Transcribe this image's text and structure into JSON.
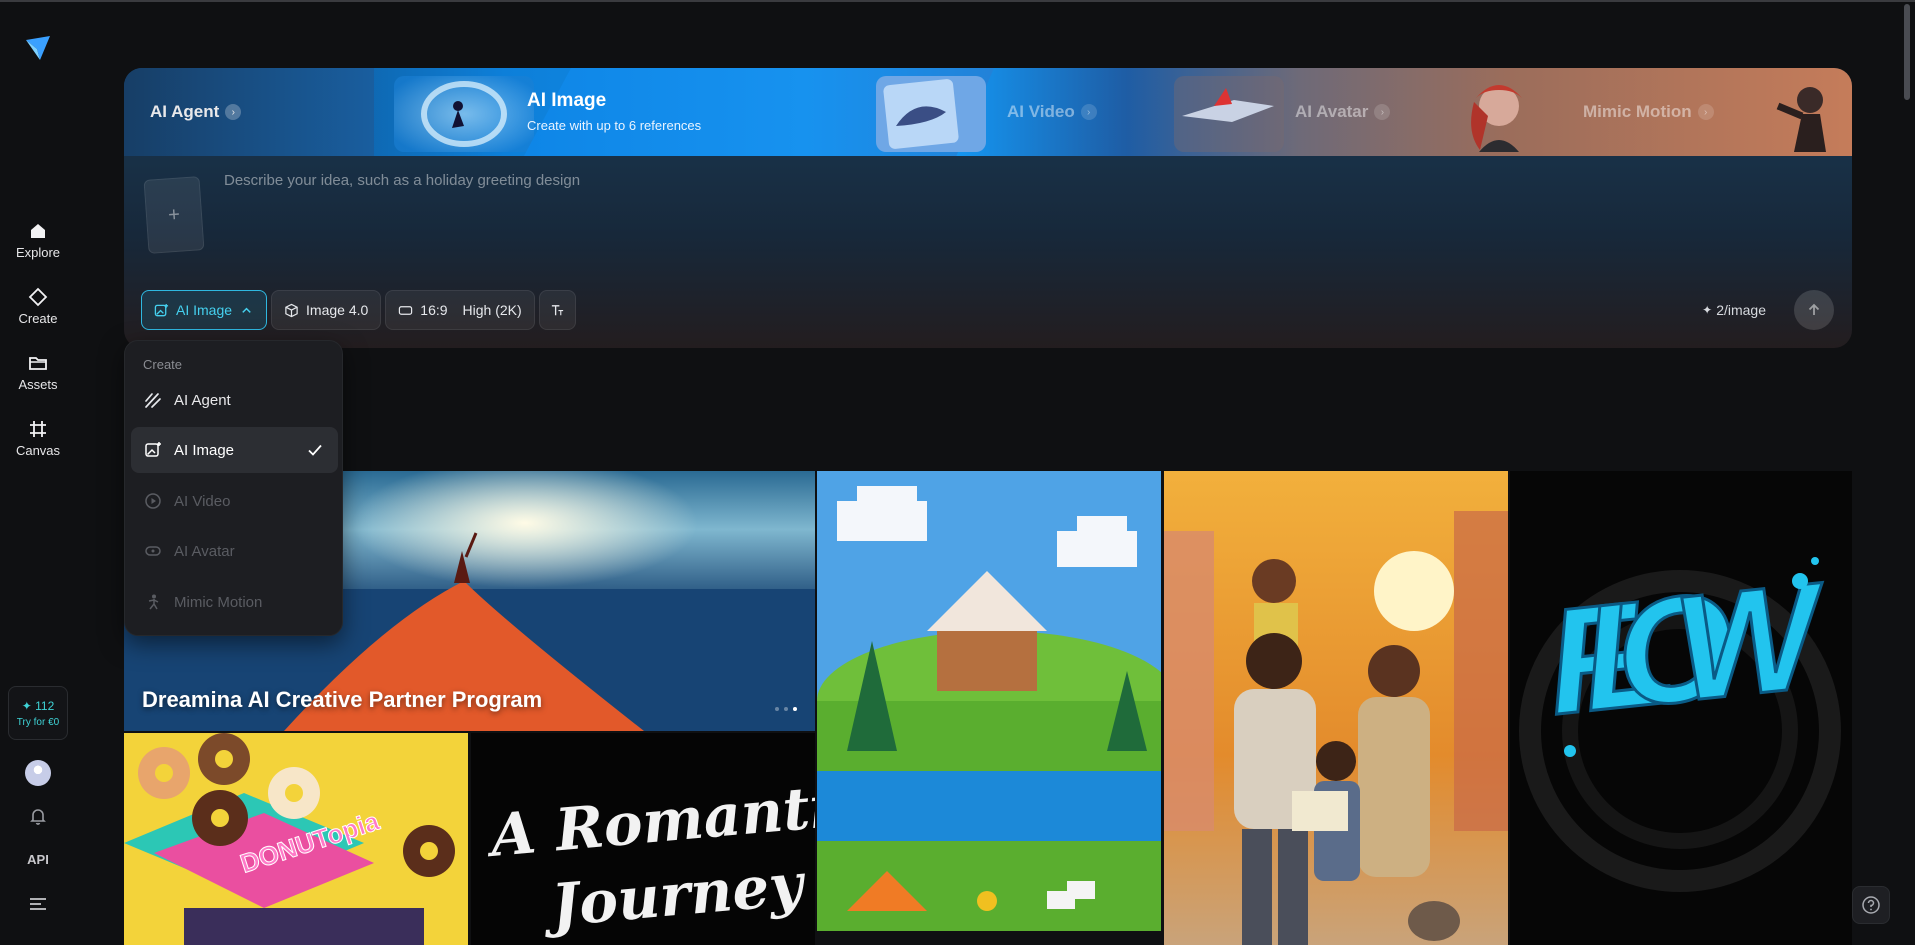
{
  "sidebar": {
    "nav": [
      {
        "label": "Explore",
        "icon": "home-icon"
      },
      {
        "label": "Create",
        "icon": "diamond-icon"
      },
      {
        "label": "Assets",
        "icon": "folder-icon"
      },
      {
        "label": "Canvas",
        "icon": "canvas-icon"
      }
    ],
    "credits": "112",
    "try_label": "Try for €0",
    "api_label": "API"
  },
  "tabs": {
    "agent": "AI Agent",
    "image_title": "AI Image",
    "image_subtitle": "Create with up to 6 references",
    "video": "AI Video",
    "avatar": "AI Avatar",
    "mimic": "Mimic Motion"
  },
  "prompt": {
    "placeholder": "Describe your idea, such as a holiday greeting design",
    "add_symbol": "+"
  },
  "toolbar": {
    "mode": "AI Image",
    "model": "Image 4.0",
    "ratio": "16:9",
    "quality": "High (2K)",
    "cost": "2/image"
  },
  "dropdown": {
    "header": "Create",
    "items": [
      {
        "label": "AI Agent",
        "state": "enabled"
      },
      {
        "label": "AI Image",
        "state": "selected"
      },
      {
        "label": "AI Video",
        "state": "disabled"
      },
      {
        "label": "AI Avatar",
        "state": "disabled"
      },
      {
        "label": "Mimic Motion",
        "state": "disabled"
      }
    ]
  },
  "gallery": {
    "banner_title": "Dreamina AI Creative Partner Program",
    "donut_sign": "DONUTopia",
    "romantic_line1": "A Romantic",
    "romantic_line2": "Journey",
    "flow_text": "FLOW"
  },
  "colors": {
    "accent": "#2fb8e0",
    "background": "#0f1012",
    "credits": "#3fd3d6"
  }
}
